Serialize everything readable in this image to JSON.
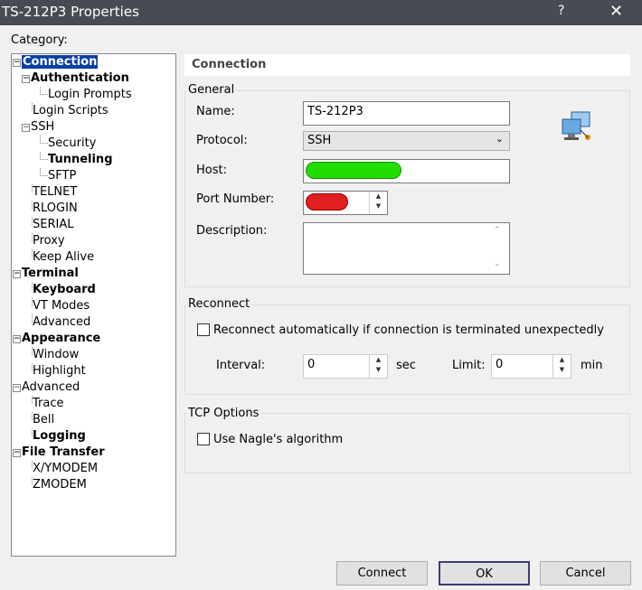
{
  "window": {
    "title": "TS-212P3 Properties",
    "help": "?",
    "close": "✕"
  },
  "category_label": "Category:",
  "tree": [
    {
      "label": "Connection",
      "level": 0,
      "bold": true,
      "expander": "⊟",
      "selected": true
    },
    {
      "label": "Authentication",
      "level": 1,
      "bold": true,
      "expander": "⊟"
    },
    {
      "label": "Login Prompts",
      "level": 2
    },
    {
      "label": "Login Scripts",
      "level": 1
    },
    {
      "label": "SSH",
      "level": 1,
      "expander": "⊟"
    },
    {
      "label": "Security",
      "level": 2
    },
    {
      "label": "Tunneling",
      "level": 2,
      "bold": true
    },
    {
      "label": "SFTP",
      "level": 2
    },
    {
      "label": "TELNET",
      "level": 1
    },
    {
      "label": "RLOGIN",
      "level": 1
    },
    {
      "label": "SERIAL",
      "level": 1
    },
    {
      "label": "Proxy",
      "level": 1
    },
    {
      "label": "Keep Alive",
      "level": 1
    },
    {
      "label": "Terminal",
      "level": 0,
      "bold": true,
      "expander": "⊟"
    },
    {
      "label": "Keyboard",
      "level": 1,
      "bold": true
    },
    {
      "label": "VT Modes",
      "level": 1
    },
    {
      "label": "Advanced",
      "level": 1
    },
    {
      "label": "Appearance",
      "level": 0,
      "bold": true,
      "expander": "⊟"
    },
    {
      "label": "Window",
      "level": 1
    },
    {
      "label": "Highlight",
      "level": 1
    },
    {
      "label": "Advanced",
      "level": 0,
      "expander": "⊟"
    },
    {
      "label": "Trace",
      "level": 1
    },
    {
      "label": "Bell",
      "level": 1
    },
    {
      "label": "Logging",
      "level": 1,
      "bold": true
    },
    {
      "label": "File Transfer",
      "level": 0,
      "bold": true,
      "expander": "⊟"
    },
    {
      "label": "X/YMODEM",
      "level": 1
    },
    {
      "label": "ZMODEM",
      "level": 1
    }
  ],
  "panel": {
    "title": "Connection"
  },
  "general": {
    "label": "General",
    "name_label": "Name:",
    "name_value": "TS-212P3",
    "protocol_label": "Protocol:",
    "protocol_value": "SSH",
    "host_label": "Host:",
    "host_redaction_color": "#22dd00",
    "port_label": "Port Number:",
    "port_redaction_color": "#e02020",
    "description_label": "Description:",
    "description_value": ""
  },
  "reconnect": {
    "label": "Reconnect",
    "checkbox_label": "Reconnect automatically if connection is terminated unexpectedly",
    "checked": false,
    "interval_label": "Interval:",
    "interval_value": "0",
    "interval_unit": "sec",
    "limit_label": "Limit:",
    "limit_value": "0",
    "limit_unit": "min"
  },
  "tcp": {
    "label": "TCP Options",
    "nagle_label": "Use Nagle's algorithm",
    "checked": false
  },
  "buttons": {
    "connect": "Connect",
    "ok": "OK",
    "cancel": "Cancel"
  }
}
